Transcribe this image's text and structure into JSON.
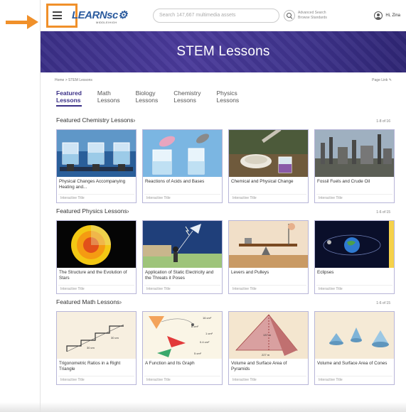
{
  "header": {
    "logo_text": "LEARNsc⚙",
    "logo_sub": "MIDDLE/HIGH",
    "search_placeholder": "Search 147,667 multimedia assets",
    "advanced_search": "Advanced Search",
    "browse_standards": "Browse Standards",
    "user_greeting": "Hi, Zina"
  },
  "banner": {
    "title": "STEM Lessons"
  },
  "breadcrumb": {
    "path": "Home > STEM Lessons",
    "page_link": "Page Link ✎"
  },
  "tabs": [
    {
      "label1": "Featured",
      "label2": "Lessons"
    },
    {
      "label1": "Math",
      "label2": "Lessons"
    },
    {
      "label1": "Biology",
      "label2": "Lessons"
    },
    {
      "label1": "Chemistry",
      "label2": "Lessons"
    },
    {
      "label1": "Physics",
      "label2": "Lessons"
    }
  ],
  "sections": [
    {
      "title": "Featured Chemistry Lessons",
      "count": "1-8 of 16",
      "cards": [
        {
          "title": "Physical Changes Accompanying Heating and...",
          "meta": "Interactive Title"
        },
        {
          "title": "Reactions of Acids and Bases",
          "meta": "Interactive Title"
        },
        {
          "title": "Chemical and Physical Change",
          "meta": "Interactive Title"
        },
        {
          "title": "Fossil Fuels and Crude Oil",
          "meta": "Interactive Title"
        }
      ]
    },
    {
      "title": "Featured Physics Lessons",
      "count": "1-6 of 15",
      "cards": [
        {
          "title": "The Structure and the Evolution of Stars",
          "meta": "Interactive Title"
        },
        {
          "title": "Application of Static Electricity and the Threats it Poses",
          "meta": "Interactive Title"
        },
        {
          "title": "Levers and Pulleys",
          "meta": "Interactive Title"
        },
        {
          "title": "Eclipses",
          "meta": "Interactive Title"
        }
      ]
    },
    {
      "title": "Featured Math Lessons",
      "count": "1-6 of 15",
      "cards": [
        {
          "title": "Trigonometric Ratios in a Right Triangle",
          "meta": "Interactive Title"
        },
        {
          "title": "A Function and Its Graph",
          "meta": "Interactive Title"
        },
        {
          "title": "Volume and Surface Area of Pyramids",
          "meta": "Interactive Title"
        },
        {
          "title": "Volume and Surface Area of Cones",
          "meta": "Interactive Title"
        }
      ]
    }
  ],
  "math_thumb_labels": {
    "stairs": [
      "30 cm",
      "30 cm"
    ],
    "function": [
      "16 cm²",
      "8 cm²",
      "1 cm²",
      "0.4 cm²",
      "5 cm²"
    ],
    "pyramid": [
      "137 m",
      "227 m"
    ]
  },
  "colors": {
    "accent": "#f0902a",
    "brand": "#3a2f86",
    "card_border": "#b7b5d8"
  }
}
